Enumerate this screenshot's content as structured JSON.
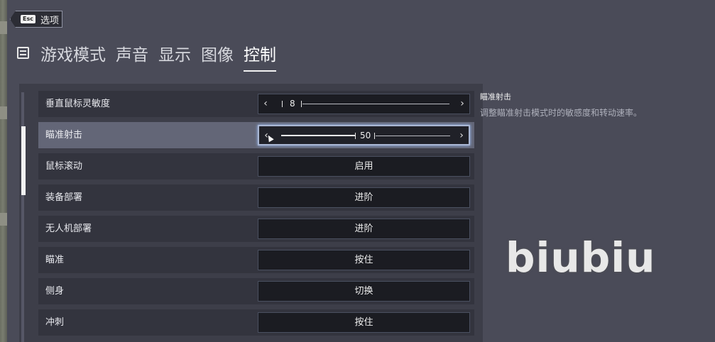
{
  "esc_button": {
    "key_label": "Esc",
    "label": "选项"
  },
  "tabs": [
    {
      "label": "游戏模式",
      "active": false
    },
    {
      "label": "声音",
      "active": false
    },
    {
      "label": "显示",
      "active": false
    },
    {
      "label": "图像",
      "active": false
    },
    {
      "label": "控制",
      "active": true
    }
  ],
  "rows": [
    {
      "label": "垂直鼠标灵敏度",
      "type": "slider",
      "value": "8",
      "fraction": 0.08
    },
    {
      "label": "瞄准射击",
      "type": "slider",
      "value": "50",
      "fraction": 0.5,
      "active": true
    },
    {
      "label": "鼠标滚动",
      "type": "toggle",
      "value": "启用"
    },
    {
      "label": "装备部署",
      "type": "toggle",
      "value": "进阶"
    },
    {
      "label": "无人机部署",
      "type": "toggle",
      "value": "进阶"
    },
    {
      "label": "瞄准",
      "type": "toggle",
      "value": "按住"
    },
    {
      "label": "侧身",
      "type": "toggle",
      "value": "切换"
    },
    {
      "label": "冲刺",
      "type": "toggle",
      "value": "按住"
    }
  ],
  "arrows": {
    "left": "‹",
    "right": "›"
  },
  "description": {
    "title": "瞄准射击",
    "text": "调整瞄准射击模式时的敏感度和转动速率。"
  },
  "watermark": "biubiu"
}
